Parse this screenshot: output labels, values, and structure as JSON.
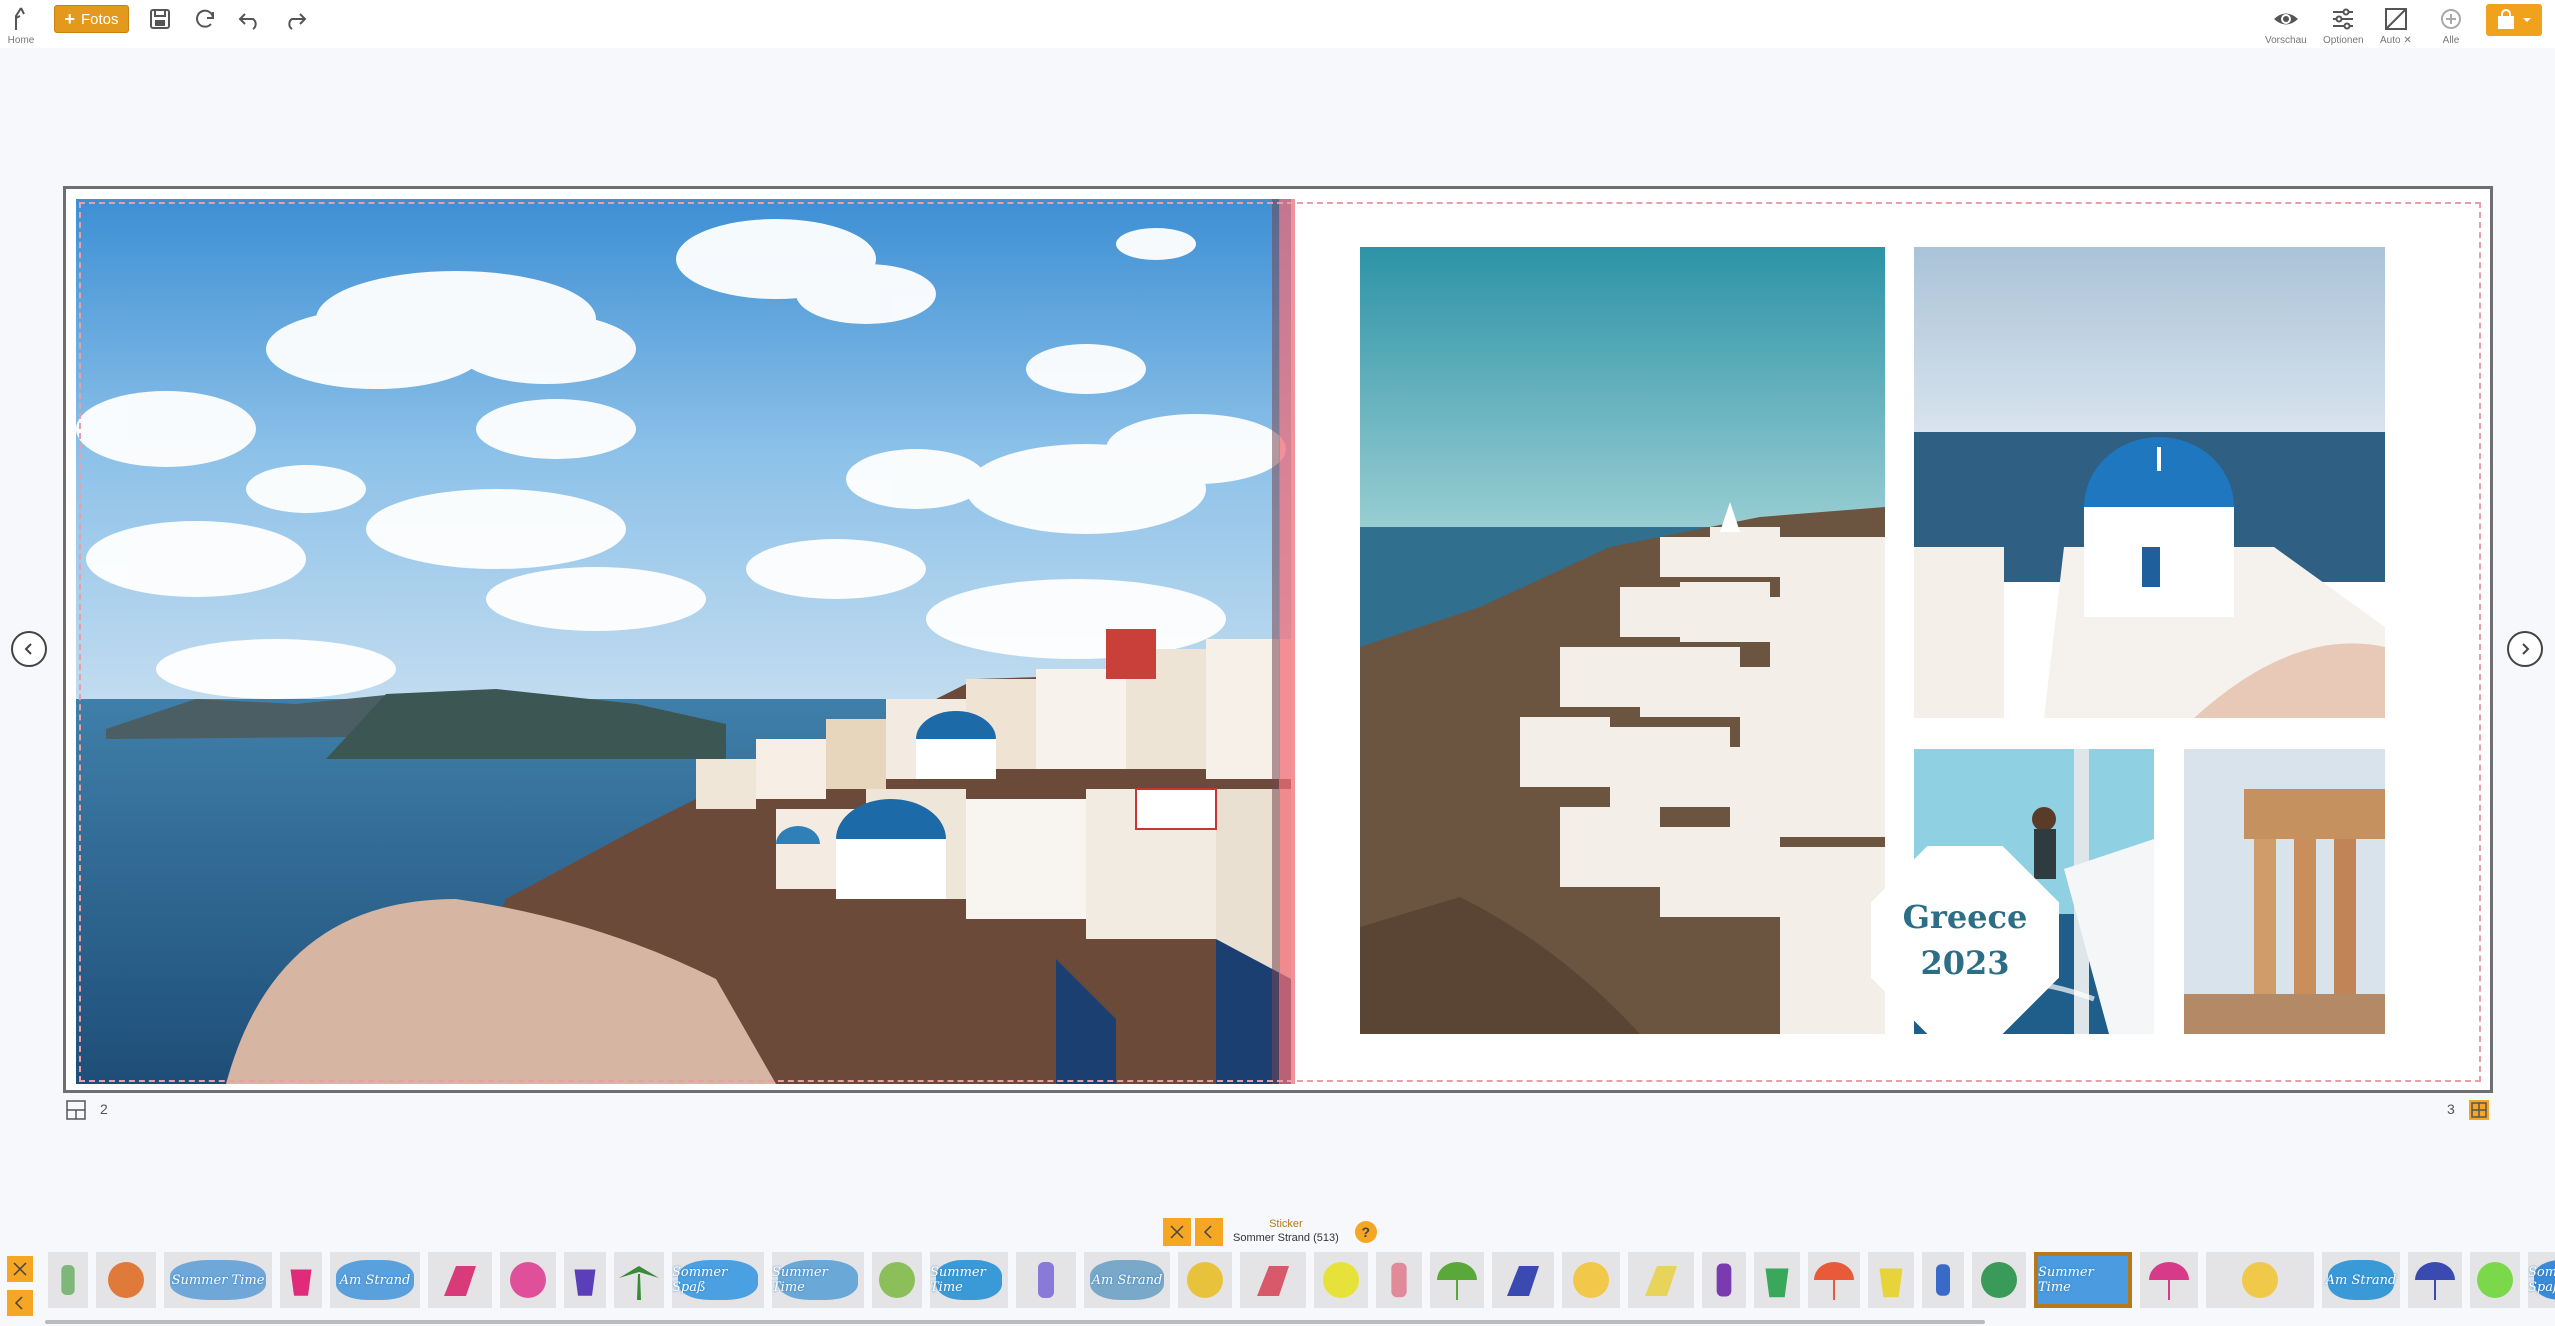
{
  "toolbar": {
    "home_label": "Home",
    "fotos_label": "Fotos",
    "preview_label": "Vorschau",
    "options_label": "Optionen",
    "auto_label": "Auto ✕",
    "all_label": "Alle"
  },
  "spread": {
    "title_line1": "Greece",
    "title_line2": "2023",
    "left_page_number": "2",
    "right_page_number": "3"
  },
  "sticker_panel": {
    "category": "Sticker",
    "name": "Sommer Strand (513)",
    "help": "?",
    "items": [
      {
        "name": "flip-flops",
        "text": ""
      },
      {
        "name": "beach-ball",
        "text": ""
      },
      {
        "name": "summer-text",
        "text": "Summer Time"
      },
      {
        "name": "pink-bucket",
        "text": ""
      },
      {
        "name": "am-strand-oval",
        "text": "Am Strand"
      },
      {
        "name": "striped-chair",
        "text": ""
      },
      {
        "name": "pink-ball",
        "text": ""
      },
      {
        "name": "blue-bucket",
        "text": ""
      },
      {
        "name": "palm-tree",
        "text": ""
      },
      {
        "name": "sommer-spass-oval",
        "text": "Sommer Spaß"
      },
      {
        "name": "summer-time-text",
        "text": "Summer Time"
      },
      {
        "name": "coconut",
        "text": ""
      },
      {
        "name": "summer-time-badge",
        "text": "Summer Time"
      },
      {
        "name": "sandals",
        "text": ""
      },
      {
        "name": "am-strand-text",
        "text": "Am Strand"
      },
      {
        "name": "yellow-ball",
        "text": ""
      },
      {
        "name": "red-chair",
        "text": ""
      },
      {
        "name": "yellow-green-ball",
        "text": ""
      },
      {
        "name": "popsicle",
        "text": ""
      },
      {
        "name": "green-umbrella",
        "text": ""
      },
      {
        "name": "blue-chair",
        "text": ""
      },
      {
        "name": "sun",
        "text": ""
      },
      {
        "name": "yellow-chair",
        "text": ""
      },
      {
        "name": "ice-pop",
        "text": ""
      },
      {
        "name": "green-bucket",
        "text": ""
      },
      {
        "name": "red-umbrella",
        "text": ""
      },
      {
        "name": "yellow-bucket",
        "text": ""
      },
      {
        "name": "blue-shovel",
        "text": ""
      },
      {
        "name": "green-ball",
        "text": ""
      },
      {
        "name": "summer-time-oval",
        "text": "Summer Time"
      },
      {
        "name": "pink-umbrella",
        "text": ""
      },
      {
        "name": "sun-cloud",
        "text": ""
      },
      {
        "name": "am-strand-badge",
        "text": "Am Strand"
      },
      {
        "name": "navy-umbrella",
        "text": ""
      },
      {
        "name": "coconut-drink",
        "text": ""
      },
      {
        "name": "sommer-spass-badge",
        "text": "Sommer Spaß"
      }
    ]
  },
  "colors": {
    "accent": "#f5a623",
    "title": "#2b6e85",
    "fold": "#f06e78"
  }
}
